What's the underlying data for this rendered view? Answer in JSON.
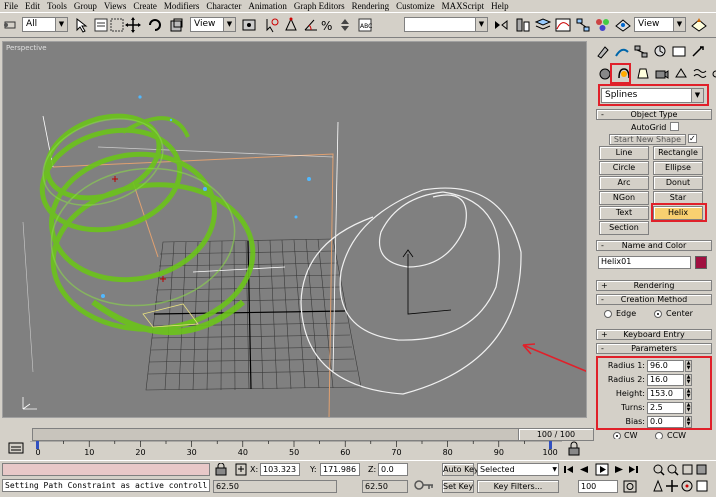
{
  "menu": [
    "File",
    "Edit",
    "Tools",
    "Group",
    "Views",
    "Create",
    "Modifiers",
    "Character",
    "Animation",
    "Graph Editors",
    "Rendering",
    "Customize",
    "MAXScript",
    "Help"
  ],
  "toolbar": {
    "selection_filter": "All",
    "ref_coord_1": "View",
    "ref_coord_2": "View",
    "named_selection": ""
  },
  "viewport": {
    "label": "Perspective"
  },
  "command_panel": {
    "category_dropdown": "Splines",
    "object_type": {
      "title": "Object Type",
      "autogrid": "AutoGrid",
      "start_new_shape": "Start New Shape",
      "buttons": [
        "Line",
        "Rectangle",
        "Circle",
        "Ellipse",
        "Arc",
        "Donut",
        "NGon",
        "Star",
        "Text",
        "Helix",
        "Section"
      ],
      "active": "Helix"
    },
    "name_color": {
      "title": "Name and Color",
      "name": "Helix01",
      "color": "#a01040"
    },
    "rendering": {
      "title": "Rendering"
    },
    "creation_method": {
      "title": "Creation Method",
      "edge": "Edge",
      "center": "Center"
    },
    "keyboard_entry": {
      "title": "Keyboard Entry"
    },
    "parameters": {
      "title": "Parameters",
      "radius1_label": "Radius 1:",
      "radius1": "96.0",
      "radius2_label": "Radius 2:",
      "radius2": "16.0",
      "height_label": "Height:",
      "height": "153.0",
      "turns_label": "Turns:",
      "turns": "2.5",
      "bias_label": "Bias:",
      "bias": "0.0",
      "cw": "CW",
      "ccw": "CCW"
    }
  },
  "timeline": {
    "frame_display": "100 / 100",
    "ticks": [
      "0",
      "10",
      "20",
      "30",
      "40",
      "50",
      "60",
      "70",
      "80",
      "90",
      "100"
    ]
  },
  "status": {
    "prompt": "Setting Path Constraint as active controll",
    "x_label": "X:",
    "x": "103.323",
    "y_label": "Y:",
    "y": "171.986",
    "z_label": "Z:",
    "z": "0.0",
    "left_val": "62.50",
    "mid_val": "62.50",
    "auto_key": "Auto Key",
    "set_key": "Set Key",
    "key_mode": "Selected",
    "key_filters": "Key Filters...",
    "frame": "100"
  },
  "colors": {
    "annotation": "#e0202a",
    "helix_green": "#6bc41a",
    "active_button": "#f8d070"
  }
}
